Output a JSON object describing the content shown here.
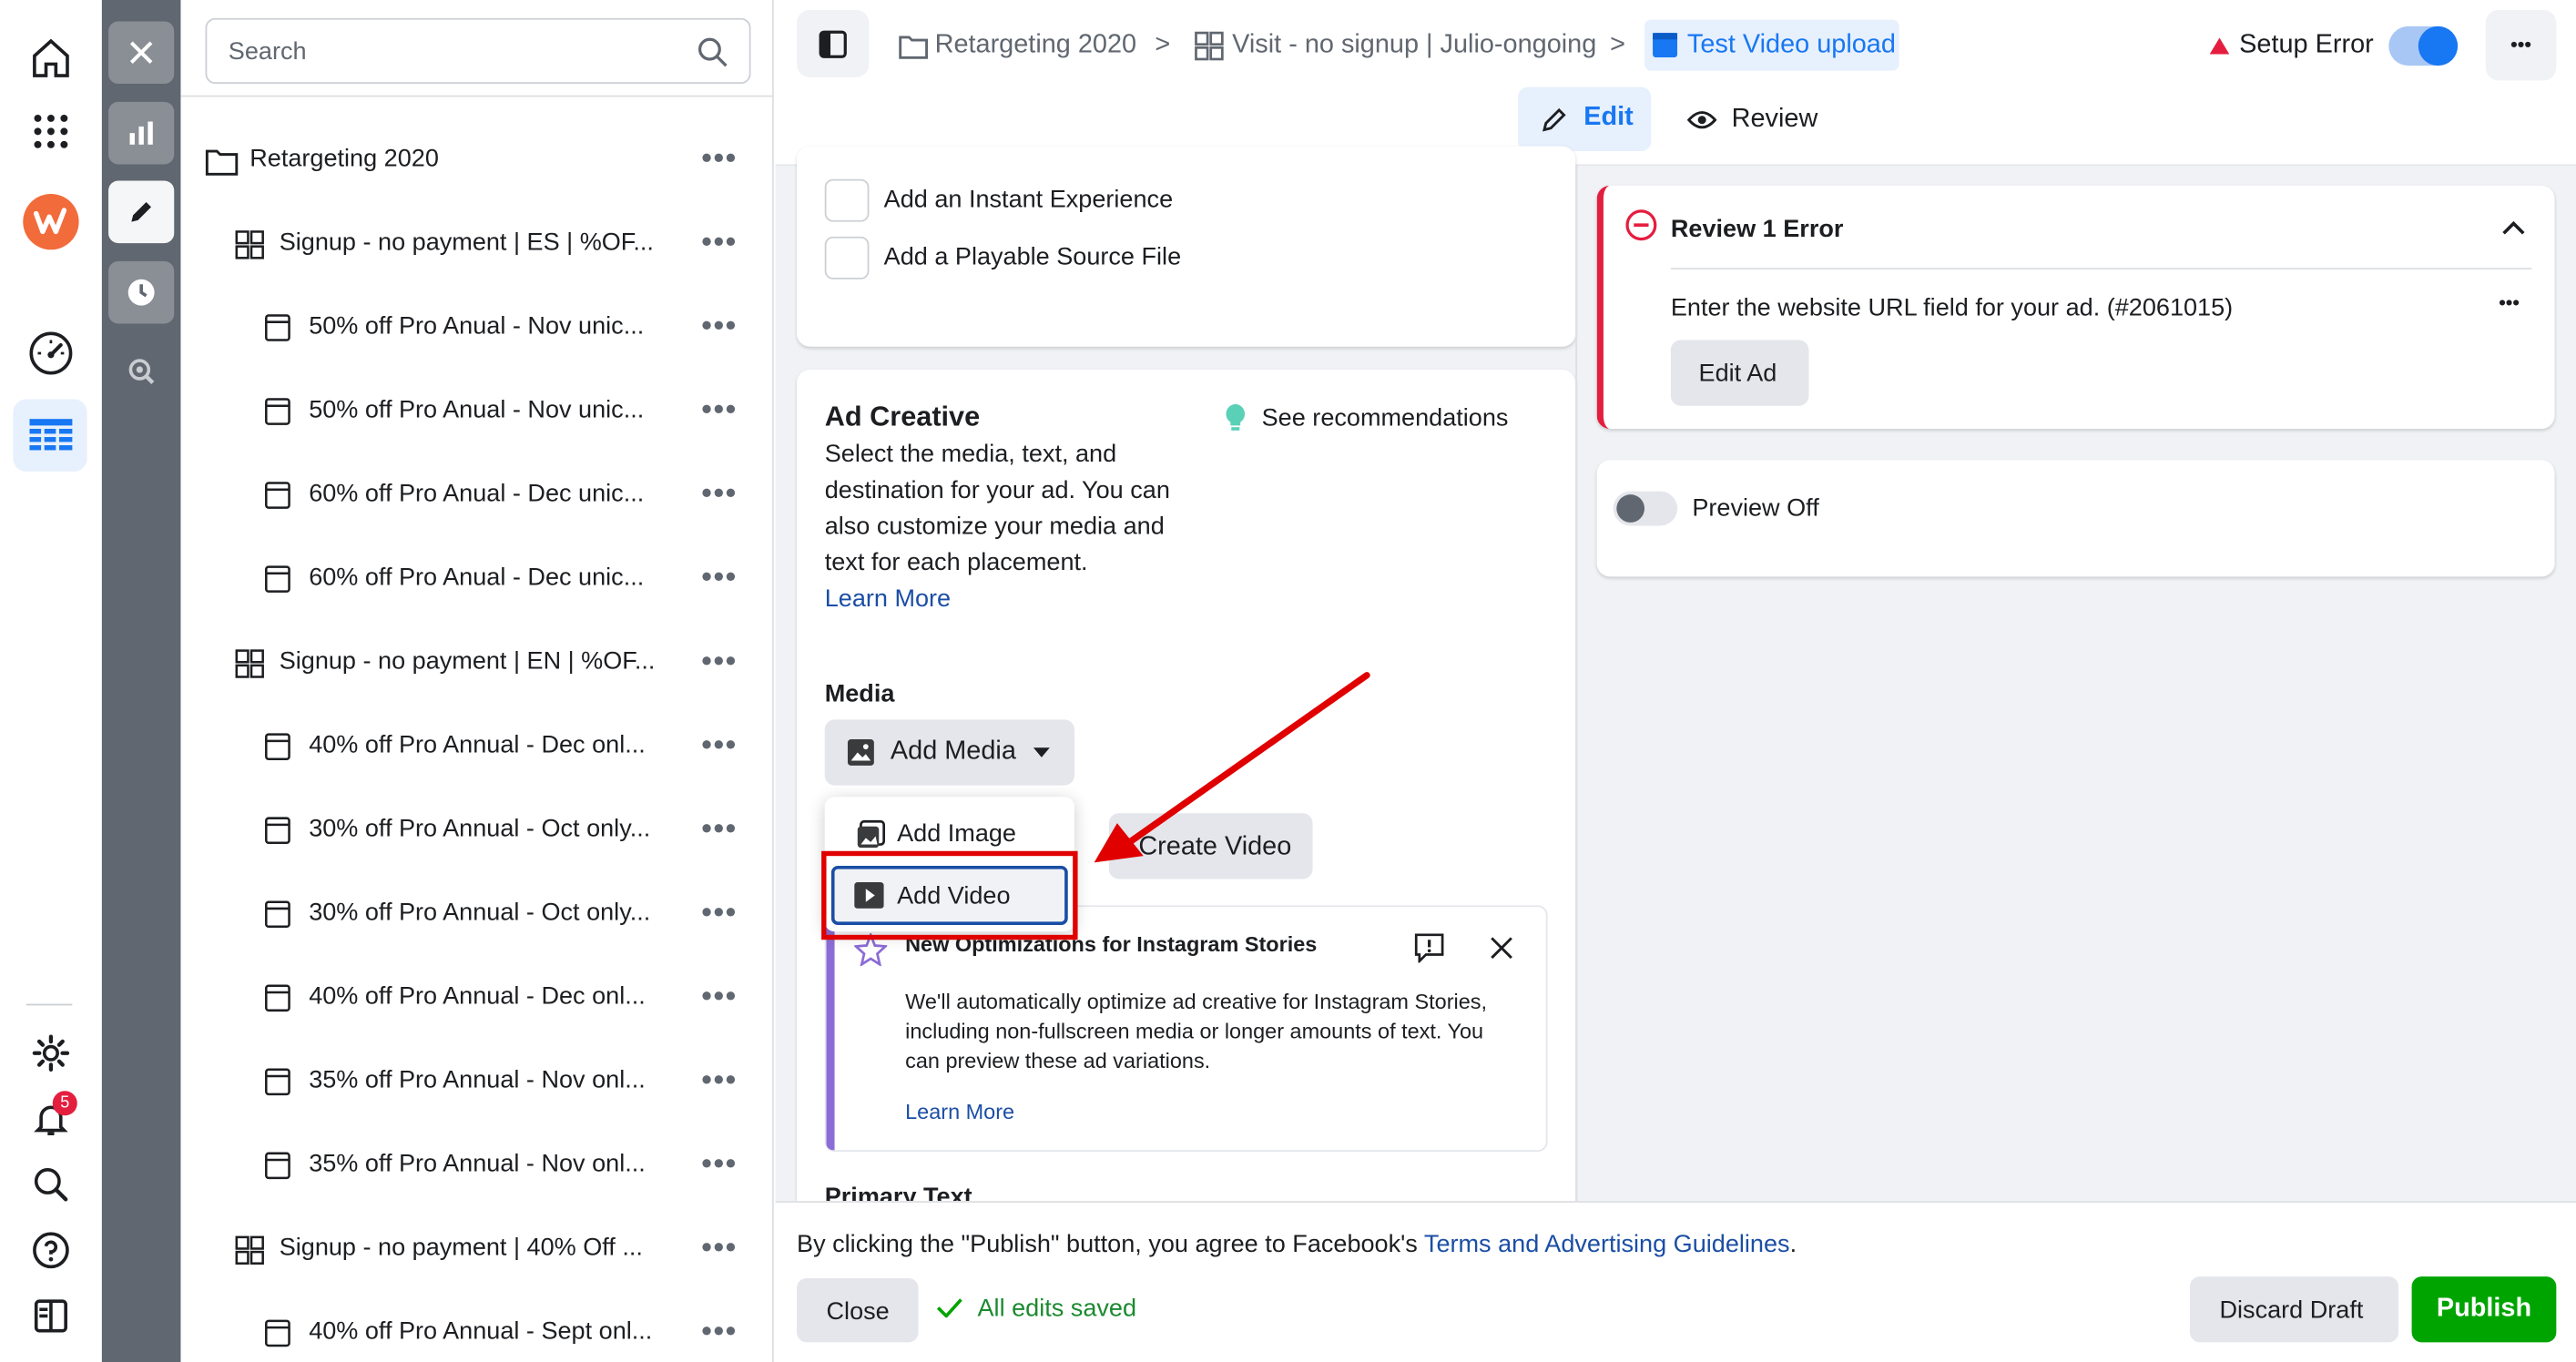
{
  "search": {
    "placeholder": "Search"
  },
  "tree": {
    "root": "Retargeting 2020",
    "items": [
      {
        "type": "adset",
        "label": "Signup - no payment | ES | %OF..."
      },
      {
        "type": "ad",
        "label": "50% off Pro Anual - Nov unic..."
      },
      {
        "type": "ad",
        "label": "50% off Pro Anual - Nov unic..."
      },
      {
        "type": "ad",
        "label": "60% off Pro Anual - Dec unic..."
      },
      {
        "type": "ad",
        "label": "60% off Pro Anual - Dec unic..."
      },
      {
        "type": "adset",
        "label": "Signup - no payment | EN | %OF..."
      },
      {
        "type": "ad",
        "label": "40% off Pro Annual - Dec onl..."
      },
      {
        "type": "ad",
        "label": "30% off Pro Annual - Oct only..."
      },
      {
        "type": "ad",
        "label": "30% off Pro Annual - Oct only..."
      },
      {
        "type": "ad",
        "label": "40% off Pro Annual - Dec onl..."
      },
      {
        "type": "ad",
        "label": "35% off Pro Annual - Nov onl..."
      },
      {
        "type": "ad",
        "label": "35% off Pro Annual - Nov onl..."
      },
      {
        "type": "adset",
        "label": "Signup - no payment | 40% Off ..."
      },
      {
        "type": "ad",
        "label": "40% off Pro Annual - Sept onl..."
      }
    ]
  },
  "rail": {
    "notifications": "5"
  },
  "breadcrumb": {
    "campaign": "Retargeting 2020",
    "adset": "Visit - no signup | Julio-ongoing",
    "ad": "Test Video upload",
    "separator": ">"
  },
  "header": {
    "status": "Setup Error",
    "more": "•••",
    "tab_edit": "Edit",
    "tab_review": "Review"
  },
  "options": {
    "instant_experience": "Add an Instant Experience",
    "playable": "Add a Playable Source File"
  },
  "creative": {
    "title": "Ad Creative",
    "recommendations": "See recommendations",
    "description": "Select the media, text, and destination for your ad. You can also customize your media and text for each placement.",
    "learn_more": "Learn More",
    "media_label": "Media",
    "add_media": "Add Media",
    "create_video": "Create Video",
    "menu_add_image": "Add Image",
    "menu_add_video": "Add Video",
    "next_section": "Primary Text"
  },
  "optimization": {
    "title": "New Optimizations for Instagram Stories",
    "body": "We'll automatically optimize ad creative for Instagram Stories, including non-fullscreen media or longer amounts of text. You can preview these ad variations.",
    "learn_more": "Learn More"
  },
  "errors": {
    "title": "Review 1 Error",
    "message": "Enter the website URL field for your ad. (#2061015)",
    "edit_button": "Edit Ad"
  },
  "preview": {
    "label": "Preview Off"
  },
  "footer": {
    "agreement": "By clicking the \"Publish\" button, you agree to Facebook's",
    "terms": "Terms and Advertising Guidelines",
    "period": ".",
    "close": "Close",
    "saved": "All edits saved",
    "discard": "Discard Draft",
    "publish": "Publish"
  },
  "colors": {
    "accent": "#1877f2",
    "error": "#e41e3f",
    "publish": "#00a400",
    "annotation": "#e00000",
    "optimization_bar": "#8c6cd6"
  }
}
